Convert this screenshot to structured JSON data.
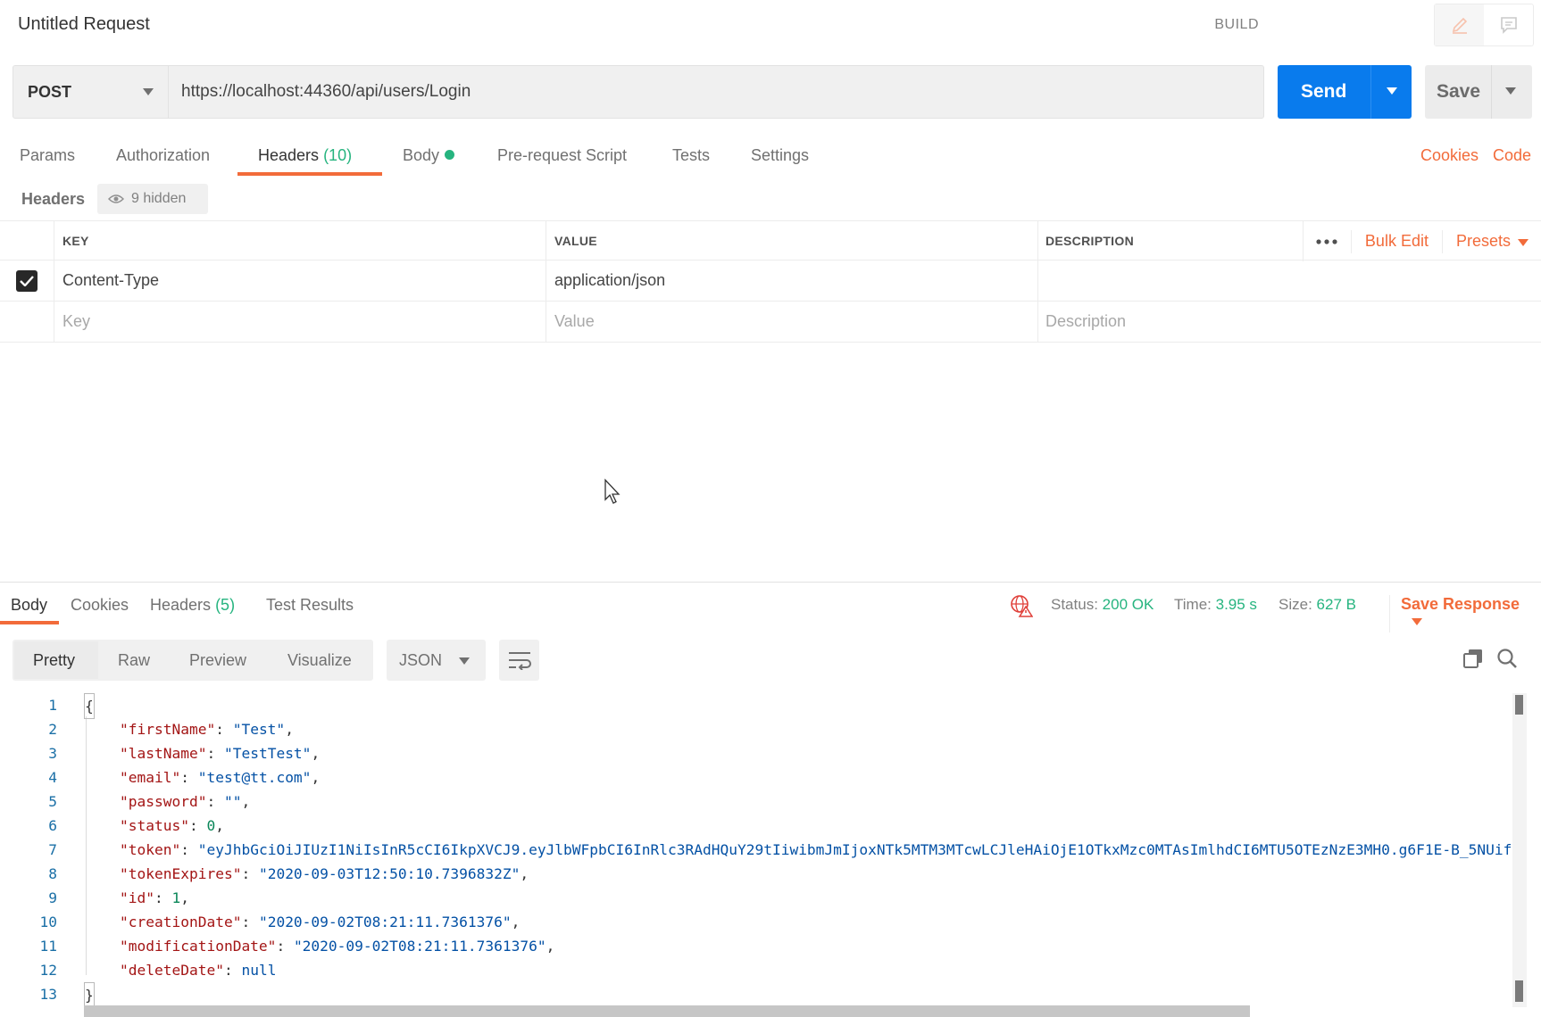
{
  "titlebar": {
    "title": "Untitled Request",
    "build": "BUILD"
  },
  "request": {
    "method": "POST",
    "url": "https://localhost:44360/api/users/Login",
    "send_label": "Send",
    "save_label": "Save"
  },
  "request_tabs": [
    {
      "label": "Params"
    },
    {
      "label": "Authorization"
    },
    {
      "label": "Headers",
      "count": "(10)"
    },
    {
      "label": "Body"
    },
    {
      "label": "Pre-request Script"
    },
    {
      "label": "Tests"
    },
    {
      "label": "Settings"
    }
  ],
  "request_links": {
    "cookies": "Cookies",
    "code": "Code"
  },
  "headers_panel": {
    "title": "Headers",
    "hidden_count": "9 hidden",
    "columns": {
      "key": "KEY",
      "value": "VALUE",
      "description": "DESCRIPTION"
    },
    "bulk_edit": "Bulk Edit",
    "presets": "Presets",
    "rows": [
      {
        "key": "Content-Type",
        "value": "application/json",
        "description": ""
      }
    ],
    "placeholders": {
      "key": "Key",
      "value": "Value",
      "description": "Description"
    }
  },
  "response_tabs": [
    {
      "label": "Body"
    },
    {
      "label": "Cookies"
    },
    {
      "label": "Headers",
      "count": "(5)"
    },
    {
      "label": "Test Results"
    }
  ],
  "response_status": {
    "status_label": "Status:",
    "status_value": "200 OK",
    "time_label": "Time:",
    "time_value": "3.95 s",
    "size_label": "Size:",
    "size_value": "627 B",
    "save_response": "Save Response"
  },
  "view_modes": [
    "Pretty",
    "Raw",
    "Preview",
    "Visualize"
  ],
  "format": "JSON",
  "colors": {
    "accent": "#f26b3a",
    "send": "#097bed",
    "success": "#26b47f"
  },
  "response_body": {
    "line_numbers": [
      "1",
      "2",
      "3",
      "4",
      "5",
      "6",
      "7",
      "8",
      "9",
      "10",
      "11",
      "12",
      "13"
    ],
    "open_brace": "{",
    "close_brace": "}",
    "fields": [
      {
        "key": "\"firstName\"",
        "value": "\"Test\"",
        "type": "s",
        "comma": ","
      },
      {
        "key": "\"lastName\"",
        "value": "\"TestTest\"",
        "type": "s",
        "comma": ","
      },
      {
        "key": "\"email\"",
        "value": "\"test@tt.com\"",
        "type": "s",
        "comma": ","
      },
      {
        "key": "\"password\"",
        "value": "\"\"",
        "type": "s",
        "comma": ","
      },
      {
        "key": "\"status\"",
        "value": "0",
        "type": "n",
        "comma": ","
      },
      {
        "key": "\"token\"",
        "value": "\"eyJhbGciOiJIUzI1NiIsInR5cCI6IkpXVCJ9.eyJlbWFpbCI6InRlc3RAdHQuY29tIiwibmJmIjoxNTk5MTM3MTcwLCJleHAiOjE1OTkxMzc0MTAsImlhdCI6MTU5OTEzNzE3MH0.g6F1E-B_5NUif",
        "type": "s",
        "comma": ""
      },
      {
        "key": "\"tokenExpires\"",
        "value": "\"2020-09-03T12:50:10.7396832Z\"",
        "type": "s",
        "comma": ","
      },
      {
        "key": "\"id\"",
        "value": "1",
        "type": "n",
        "comma": ","
      },
      {
        "key": "\"creationDate\"",
        "value": "\"2020-09-02T08:21:11.7361376\"",
        "type": "s",
        "comma": ","
      },
      {
        "key": "\"modificationDate\"",
        "value": "\"2020-09-02T08:21:11.7361376\"",
        "type": "s",
        "comma": ","
      },
      {
        "key": "\"deleteDate\"",
        "value": "null",
        "type": "b",
        "comma": ""
      }
    ]
  }
}
